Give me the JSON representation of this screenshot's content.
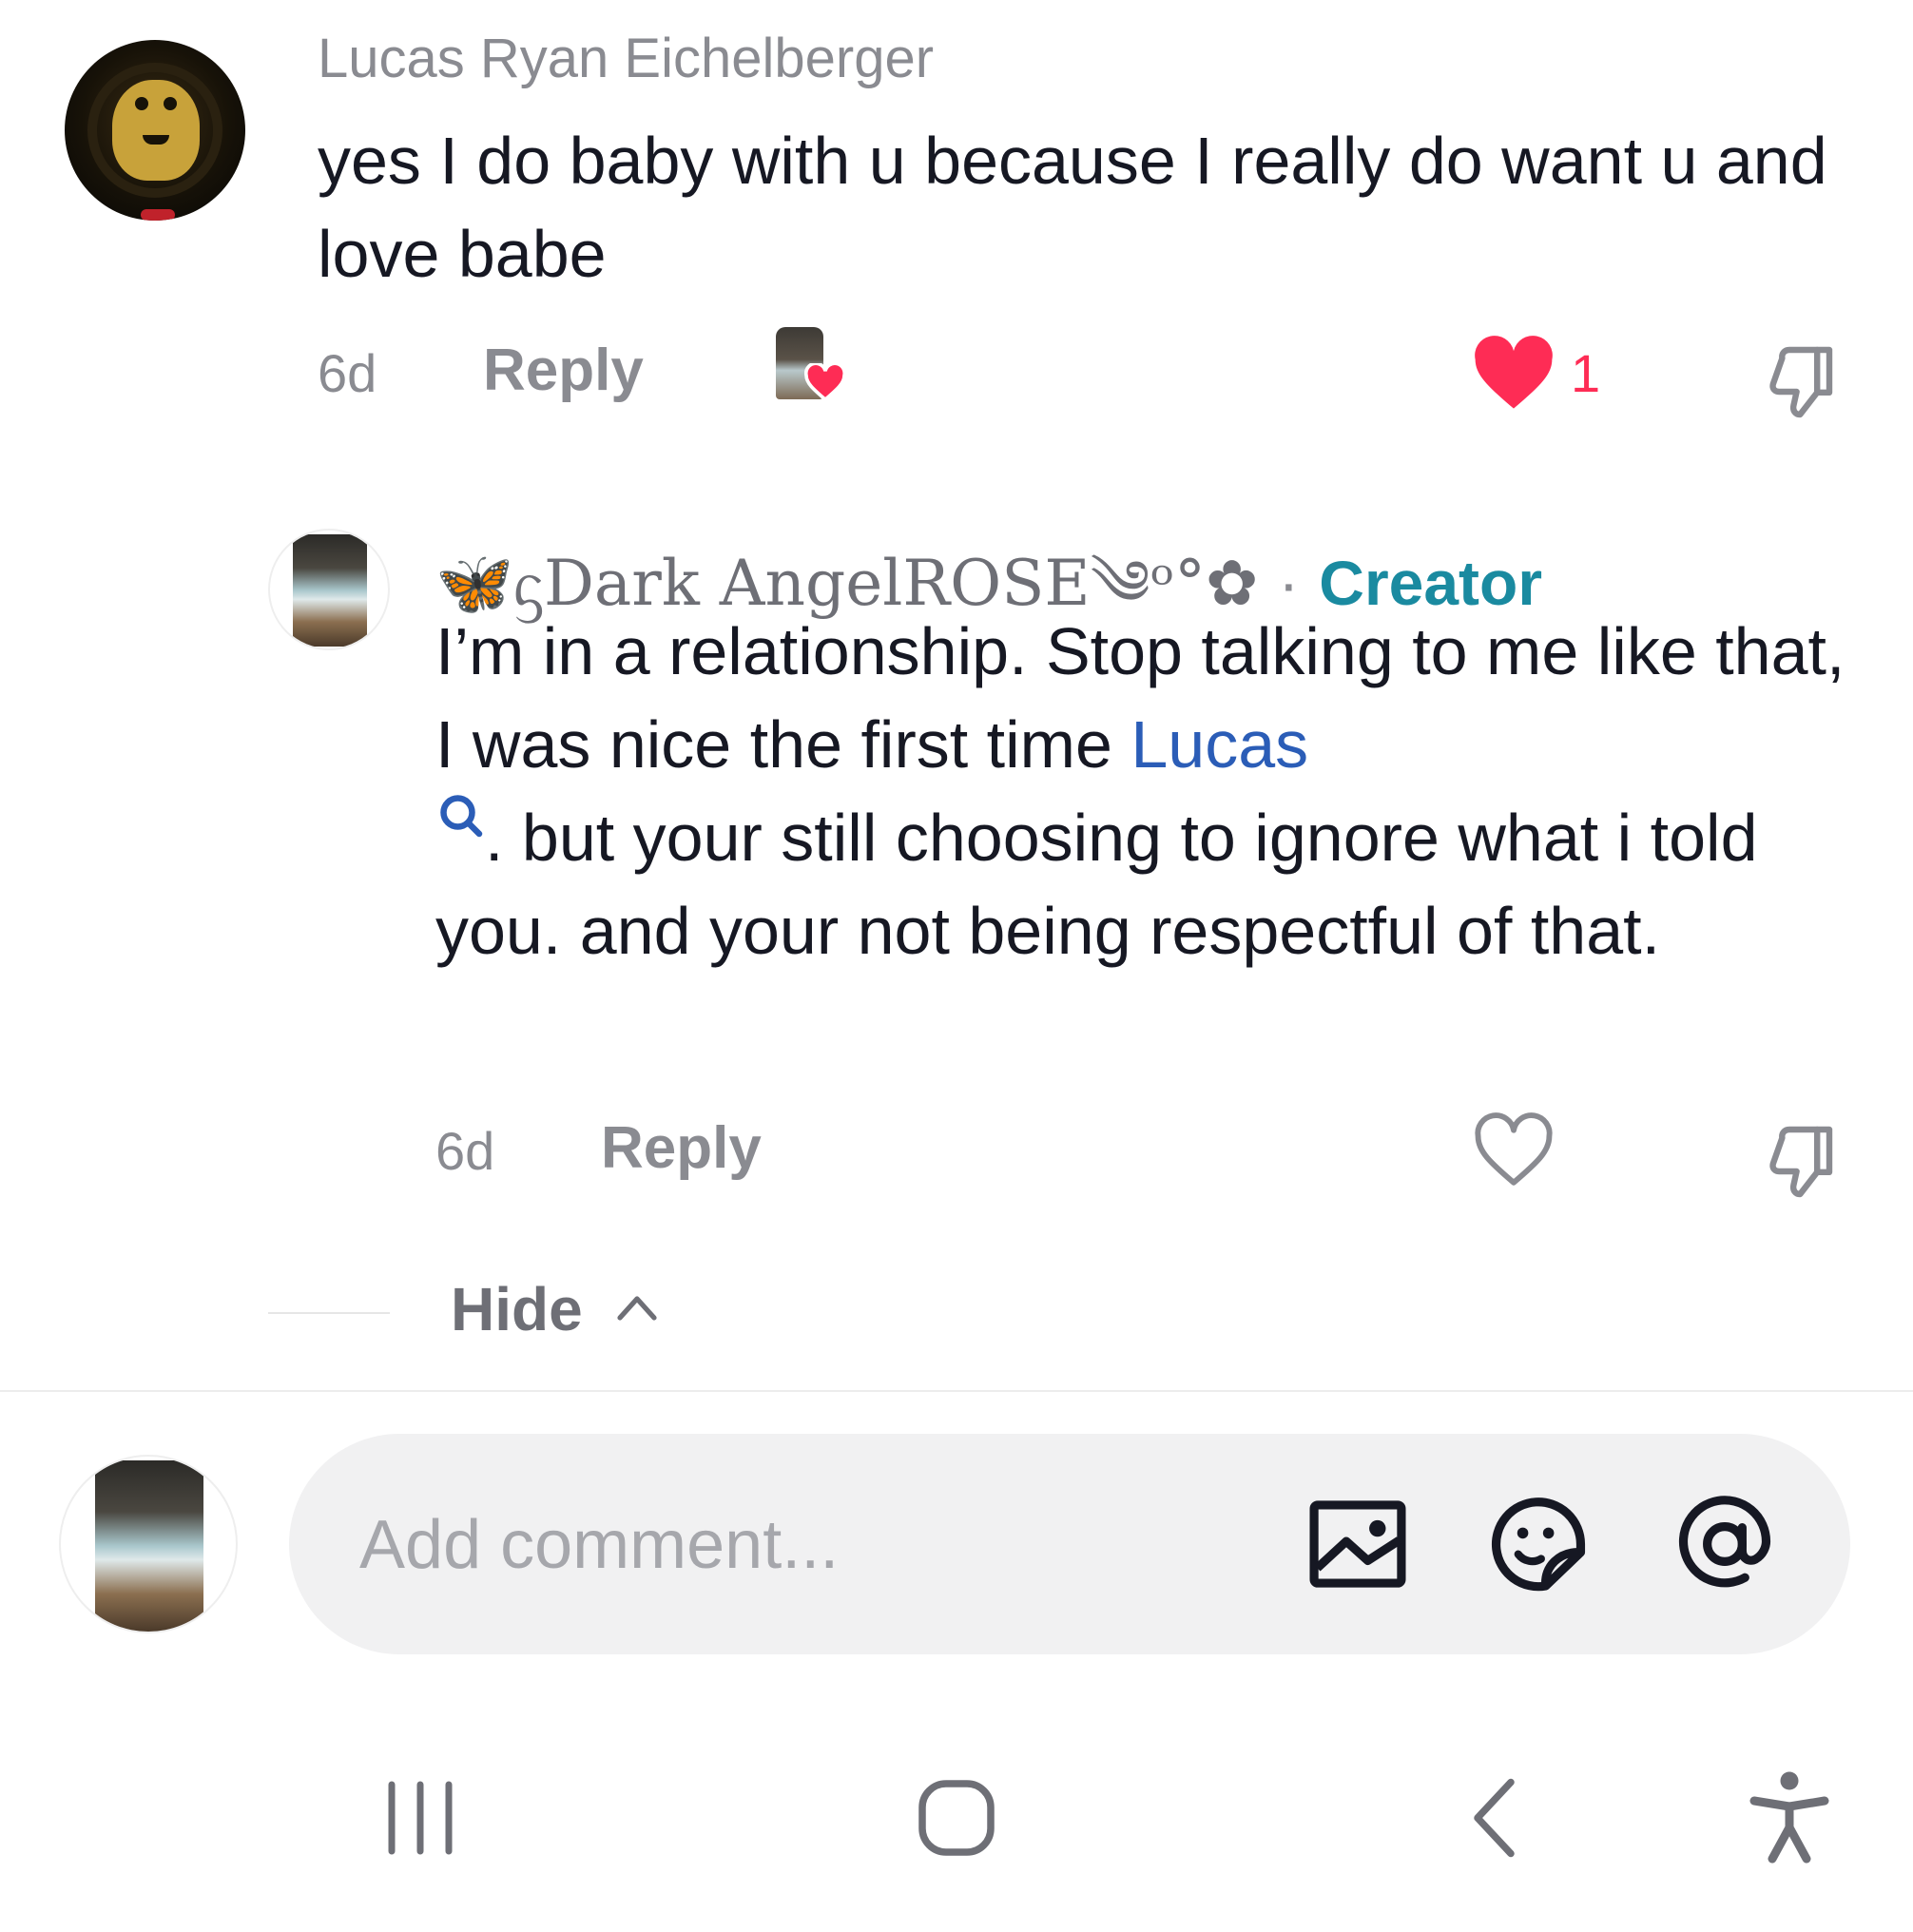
{
  "comment": {
    "username": "Lucas Ryan Eichelberger",
    "text": "yes I do baby with u because I really do want u and love babe",
    "time": "6d",
    "reply_label": "Reply",
    "like_count": "1",
    "creator_liked": true,
    "icons": [
      "cobra-kai-avatar",
      "creator-liked-heart-icon",
      "heart-filled-icon",
      "dislike-icon"
    ],
    "colors": {
      "like": "#fe2c55",
      "muted": "#8a8b91"
    }
  },
  "reply": {
    "username": "🦋ᦓDark AngelROSE༄ᵒ°✿",
    "separator": "·",
    "badge": "Creator",
    "text_before": "I’m in a relationship. Stop talking to me like that, I was nice the first time ",
    "mention": "Lucas",
    "text_after": ". but your still choosing to ignore what i told you. and your not being respectful of that.",
    "time": "6d",
    "reply_label": "Reply",
    "icons": [
      "heart-outline-icon",
      "dislike-icon",
      "search-icon"
    ],
    "colors": {
      "creator": "#1a8aa0",
      "mention": "#2b5db7"
    }
  },
  "thread": {
    "hide_label": "Hide"
  },
  "composer": {
    "placeholder": "Add comment...",
    "icons": [
      "image-icon",
      "sticker-emoji-icon",
      "mention-at-icon"
    ]
  },
  "system_nav": {
    "icons": [
      "recent-apps-icon",
      "home-icon",
      "back-icon",
      "accessibility-icon"
    ]
  }
}
